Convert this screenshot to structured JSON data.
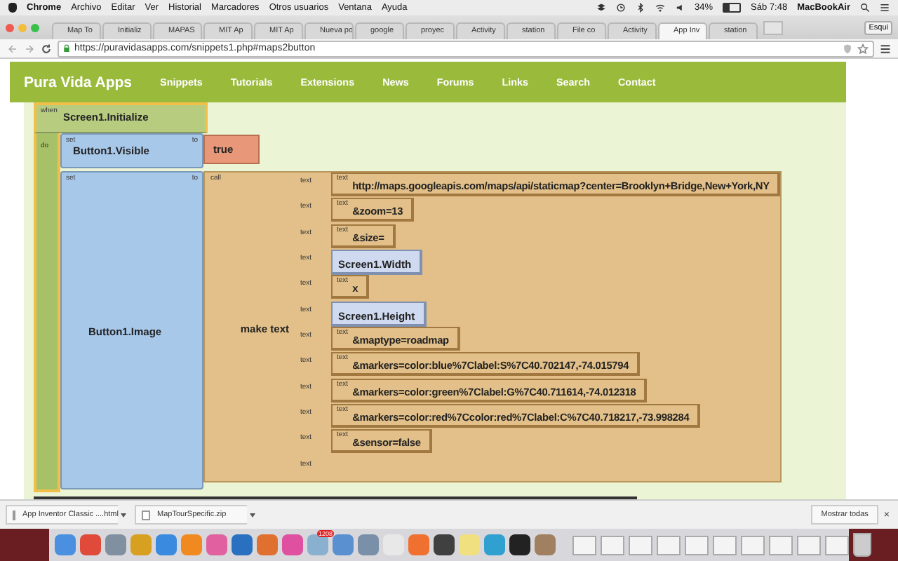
{
  "menubar": {
    "items": [
      {
        "label": "Chrome",
        "bold": true
      },
      {
        "label": "Archivo",
        "bold": false
      },
      {
        "label": "Editar",
        "bold": false
      },
      {
        "label": "Ver",
        "bold": false
      },
      {
        "label": "Historial",
        "bold": false
      },
      {
        "label": "Marcadores",
        "bold": false
      },
      {
        "label": "Otros usuarios",
        "bold": false
      },
      {
        "label": "Ventana",
        "bold": false
      },
      {
        "label": "Ayuda",
        "bold": false
      }
    ],
    "battery": "34%",
    "level": 0.34,
    "clock": "Sáb 7:48",
    "computer": "MacBookAir"
  },
  "tabs": [
    {
      "label": "Map To",
      "selected": false
    },
    {
      "label": "Initializ",
      "selected": false
    },
    {
      "label": "MAPAS",
      "selected": false
    },
    {
      "label": "MIT Ap",
      "selected": false
    },
    {
      "label": "MIT Ap",
      "selected": false
    },
    {
      "label": "Nueva po",
      "selected": false
    },
    {
      "label": "google",
      "selected": false
    },
    {
      "label": "proyec",
      "selected": false
    },
    {
      "label": "Activity",
      "selected": false
    },
    {
      "label": "station",
      "selected": false
    },
    {
      "label": "File co",
      "selected": false
    },
    {
      "label": "Activity",
      "selected": false
    },
    {
      "label": "App Inv",
      "selected": true
    },
    {
      "label": "station",
      "selected": false
    }
  ],
  "profile": "Esqui",
  "address_bar": {
    "url": "https://puravidasapps.com/snippets1.php#maps2button"
  },
  "site": {
    "brand": "Pura Vida Apps",
    "nav": [
      "Snippets",
      "Tutorials",
      "Extensions",
      "News",
      "Forums",
      "Links",
      "Search",
      "Contact"
    ]
  },
  "blocks": {
    "event": {
      "keyword": "when",
      "name": "Screen1.Initialize",
      "do": "do"
    },
    "statements": [
      {
        "set": "set",
        "property": "Button1.Visible",
        "to": "to",
        "value": "true"
      },
      {
        "set": "set",
        "property": "Button1.Image",
        "to": "to",
        "call": "call",
        "function": "make text",
        "args": [
          {
            "socket": "text",
            "kind": "text",
            "label": "text",
            "value": "http://maps.googleapis.com/maps/api/staticmap?center=Brooklyn+Bridge,New+York,NY"
          },
          {
            "socket": "text",
            "kind": "text",
            "label": "text",
            "value": "&zoom=13"
          },
          {
            "socket": "text",
            "kind": "text",
            "label": "text",
            "value": "&size="
          },
          {
            "socket": "text",
            "kind": "getter",
            "value": "Screen1.Width"
          },
          {
            "socket": "text",
            "kind": "text",
            "label": "text",
            "value": "x"
          },
          {
            "socket": "text",
            "kind": "getter",
            "value": "Screen1.Height"
          },
          {
            "socket": "text",
            "kind": "text",
            "label": "text",
            "value": "&maptype=roadmap"
          },
          {
            "socket": "text",
            "kind": "text",
            "label": "text",
            "value": "&markers=color:blue%7Clabel:S%7C40.702147,-74.015794"
          },
          {
            "socket": "text",
            "kind": "text",
            "label": "text",
            "value": "&markers=color:green%7Clabel:G%7C40.711614,-74.012318"
          },
          {
            "socket": "text",
            "kind": "text",
            "label": "text",
            "value": "&markers=color:red%7Ccolor:red%7Clabel:C%7C40.718217,-73.998284"
          },
          {
            "socket": "text",
            "kind": "text",
            "label": "text",
            "value": "&sensor=false"
          },
          {
            "socket": "text",
            "kind": "empty"
          }
        ]
      }
    ]
  },
  "downloads": {
    "items": [
      "App Inventor Classic ....html",
      "MapTourSpecific.zip"
    ],
    "show_all": "Mostrar todas",
    "close": "×"
  },
  "dock": {
    "badge": "1208"
  }
}
